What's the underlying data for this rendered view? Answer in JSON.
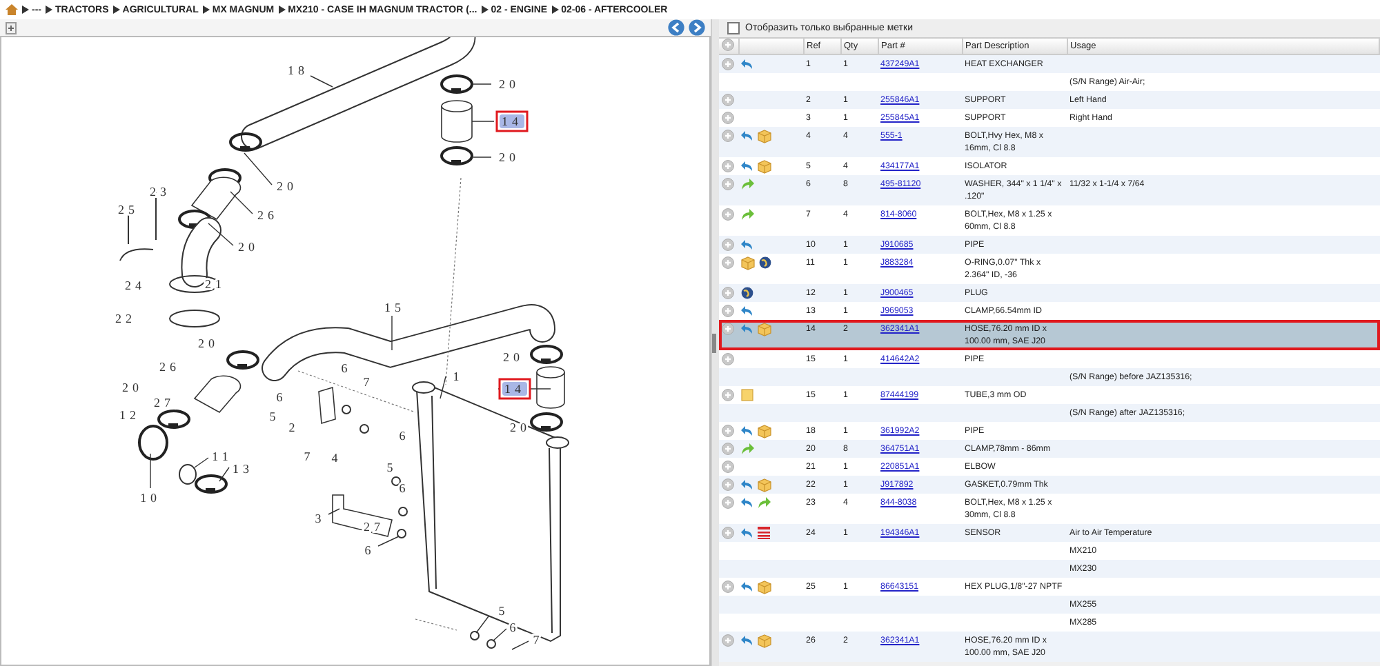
{
  "breadcrumb": [
    "---",
    "TRACTORS",
    "AGRICULTURAL",
    "MX MAGNUM",
    "MX210 - CASE IH MAGNUM TRACTOR (...",
    "02 - ENGINE",
    "02-06 - AFTERCOOLER"
  ],
  "diagram": {
    "callouts": [
      {
        "text": "18",
        "selected": false
      },
      {
        "text": "20",
        "selected": false
      },
      {
        "text": "14",
        "selected": true
      },
      {
        "text": "20",
        "selected": false
      },
      {
        "text": "20",
        "selected": false
      },
      {
        "text": "26",
        "selected": false
      },
      {
        "text": "20",
        "selected": false
      },
      {
        "text": "23",
        "selected": false
      },
      {
        "text": "25",
        "selected": false
      },
      {
        "text": "24",
        "selected": false
      },
      {
        "text": "21",
        "selected": false
      },
      {
        "text": "22",
        "selected": false
      },
      {
        "text": "15",
        "selected": false
      },
      {
        "text": "20",
        "selected": false
      },
      {
        "text": "26",
        "selected": false
      },
      {
        "text": "20",
        "selected": false
      },
      {
        "text": "12",
        "selected": false
      },
      {
        "text": "10",
        "selected": false
      },
      {
        "text": "11",
        "selected": false
      },
      {
        "text": "13",
        "selected": false
      },
      {
        "text": "27",
        "selected": false
      },
      {
        "text": "6",
        "selected": false
      },
      {
        "text": "5",
        "selected": false
      },
      {
        "text": "2",
        "selected": false
      },
      {
        "text": "6",
        "selected": false
      },
      {
        "text": "7",
        "selected": false
      },
      {
        "text": "1",
        "selected": false
      },
      {
        "text": "20",
        "selected": false
      },
      {
        "text": "14",
        "selected": true
      },
      {
        "text": "20",
        "selected": false
      },
      {
        "text": "6",
        "selected": false
      },
      {
        "text": "7",
        "selected": false
      },
      {
        "text": "4",
        "selected": false
      },
      {
        "text": "5",
        "selected": false
      },
      {
        "text": "6",
        "selected": false
      },
      {
        "text": "3",
        "selected": false
      },
      {
        "text": "27",
        "selected": false
      },
      {
        "text": "6",
        "selected": false
      },
      {
        "text": "5",
        "selected": false
      },
      {
        "text": "6",
        "selected": false
      },
      {
        "text": "7",
        "selected": false
      }
    ]
  },
  "filter": {
    "label": "Отобразить только выбранные метки",
    "checked": false
  },
  "table": {
    "columns": [
      "Ref",
      "Qty",
      "Part #",
      "Part Description",
      "Usage"
    ],
    "rows": [
      {
        "kind": "part",
        "icons": [
          {
            "kind": "reply"
          }
        ],
        "ref": "1",
        "qty": "1",
        "part": "437249A1",
        "description": "HEAT EXCHANGER",
        "usage": "",
        "selected": false
      },
      {
        "kind": "note",
        "usage": "(S/N Range) Air-Air;",
        "selected": false
      },
      {
        "kind": "part",
        "icons": [],
        "ref": "2",
        "qty": "1",
        "part": "255846A1",
        "description": "SUPPORT",
        "usage": "Left Hand",
        "selected": false
      },
      {
        "kind": "part",
        "icons": [],
        "ref": "3",
        "qty": "1",
        "part": "255845A1",
        "description": "SUPPORT",
        "usage": "Right Hand",
        "selected": false
      },
      {
        "kind": "part",
        "icons": [
          {
            "kind": "reply"
          },
          {
            "kind": "box"
          }
        ],
        "ref": "4",
        "qty": "4",
        "part": "555-1",
        "description": "BOLT,Hvy Hex, M8 x 16mm, Cl 8.8",
        "usage": "",
        "selected": false
      },
      {
        "kind": "part",
        "icons": [
          {
            "kind": "reply"
          },
          {
            "kind": "box"
          }
        ],
        "ref": "5",
        "qty": "4",
        "part": "434177A1",
        "description": "ISOLATOR",
        "usage": "",
        "selected": false
      },
      {
        "kind": "part",
        "icons": [
          {
            "kind": "forward"
          }
        ],
        "ref": "6",
        "qty": "8",
        "part": "495-81120",
        "description": "WASHER, 344\" x 1 1/4\" x .120\"",
        "usage": "11/32 x 1-1/4 x 7/64",
        "selected": false
      },
      {
        "kind": "part",
        "icons": [
          {
            "kind": "forward"
          }
        ],
        "ref": "7",
        "qty": "4",
        "part": "814-8060",
        "description": "BOLT,Hex, M8 x 1.25 x 60mm, Cl 8.8",
        "usage": "",
        "selected": false
      },
      {
        "kind": "part",
        "icons": [
          {
            "kind": "reply"
          }
        ],
        "ref": "10",
        "qty": "1",
        "part": "J910685",
        "description": "PIPE",
        "usage": "",
        "selected": false
      },
      {
        "kind": "part",
        "icons": [
          {
            "kind": "box"
          },
          {
            "kind": "globe"
          }
        ],
        "ref": "11",
        "qty": "1",
        "part": "J883284",
        "description": "O-RING,0.07\" Thk x 2.364\" ID, -36",
        "usage": "",
        "selected": false
      },
      {
        "kind": "part",
        "icons": [
          {
            "kind": "globe"
          }
        ],
        "ref": "12",
        "qty": "1",
        "part": "J900465",
        "description": "PLUG",
        "usage": "",
        "selected": false
      },
      {
        "kind": "part",
        "icons": [
          {
            "kind": "reply"
          }
        ],
        "ref": "13",
        "qty": "1",
        "part": "J969053",
        "description": "CLAMP,66.54mm ID",
        "usage": "",
        "selected": false
      },
      {
        "kind": "part",
        "icons": [
          {
            "kind": "reply"
          },
          {
            "kind": "box"
          }
        ],
        "ref": "14",
        "qty": "2",
        "part": "362341A1",
        "description": "HOSE,76.20 mm ID x 100.00 mm, SAE J20",
        "usage": "",
        "selected": true
      },
      {
        "kind": "part",
        "icons": [],
        "ref": "15",
        "qty": "1",
        "part": "414642A2",
        "description": "PIPE",
        "usage": "",
        "selected": false
      },
      {
        "kind": "note",
        "usage": "(S/N Range) before JAZ135316;",
        "selected": false
      },
      {
        "kind": "part",
        "icons": [
          {
            "kind": "note"
          }
        ],
        "ref": "15",
        "qty": "1",
        "part": "87444199",
        "description": "TUBE,3 mm OD",
        "usage": "",
        "selected": false
      },
      {
        "kind": "note",
        "usage": "(S/N Range) after JAZ135316;",
        "selected": false
      },
      {
        "kind": "part",
        "icons": [
          {
            "kind": "reply"
          },
          {
            "kind": "box"
          }
        ],
        "ref": "18",
        "qty": "1",
        "part": "361992A2",
        "description": "PIPE",
        "usage": "",
        "selected": false
      },
      {
        "kind": "part",
        "icons": [
          {
            "kind": "forward"
          }
        ],
        "ref": "20",
        "qty": "8",
        "part": "364751A1",
        "description": "CLAMP,78mm - 86mm",
        "usage": "",
        "selected": false
      },
      {
        "kind": "part",
        "icons": [],
        "ref": "21",
        "qty": "1",
        "part": "220851A1",
        "description": "ELBOW",
        "usage": "",
        "selected": false
      },
      {
        "kind": "part",
        "icons": [
          {
            "kind": "reply"
          },
          {
            "kind": "box"
          }
        ],
        "ref": "22",
        "qty": "1",
        "part": "J917892",
        "description": "GASKET,0.79mm Thk",
        "usage": "",
        "selected": false
      },
      {
        "kind": "part",
        "icons": [
          {
            "kind": "reply"
          },
          {
            "kind": "forward"
          }
        ],
        "ref": "23",
        "qty": "4",
        "part": "844-8038",
        "description": "BOLT,Hex, M8 x 1.25 x 30mm, Cl 8.8",
        "usage": "",
        "selected": false
      },
      {
        "kind": "part",
        "icons": [
          {
            "kind": "reply"
          },
          {
            "kind": "list"
          }
        ],
        "ref": "24",
        "qty": "1",
        "part": "194346A1",
        "description": "SENSOR",
        "usage": "Air to Air Temperature",
        "selected": false
      },
      {
        "kind": "note",
        "usage": "MX210",
        "selected": false
      },
      {
        "kind": "note",
        "usage": "MX230",
        "selected": false
      },
      {
        "kind": "part",
        "icons": [
          {
            "kind": "reply"
          },
          {
            "kind": "box"
          }
        ],
        "ref": "25",
        "qty": "1",
        "part": "86643151",
        "description": "HEX PLUG,1/8\"-27 NPTF",
        "usage": "",
        "selected": false
      },
      {
        "kind": "note",
        "usage": "MX255",
        "selected": false
      },
      {
        "kind": "note",
        "usage": "MX285",
        "selected": false
      },
      {
        "kind": "part",
        "icons": [
          {
            "kind": "reply"
          },
          {
            "kind": "box"
          }
        ],
        "ref": "26",
        "qty": "2",
        "part": "362341A1",
        "description": "HOSE,76.20 mm ID x 100.00 mm, SAE J20",
        "usage": "",
        "selected": false
      }
    ]
  }
}
